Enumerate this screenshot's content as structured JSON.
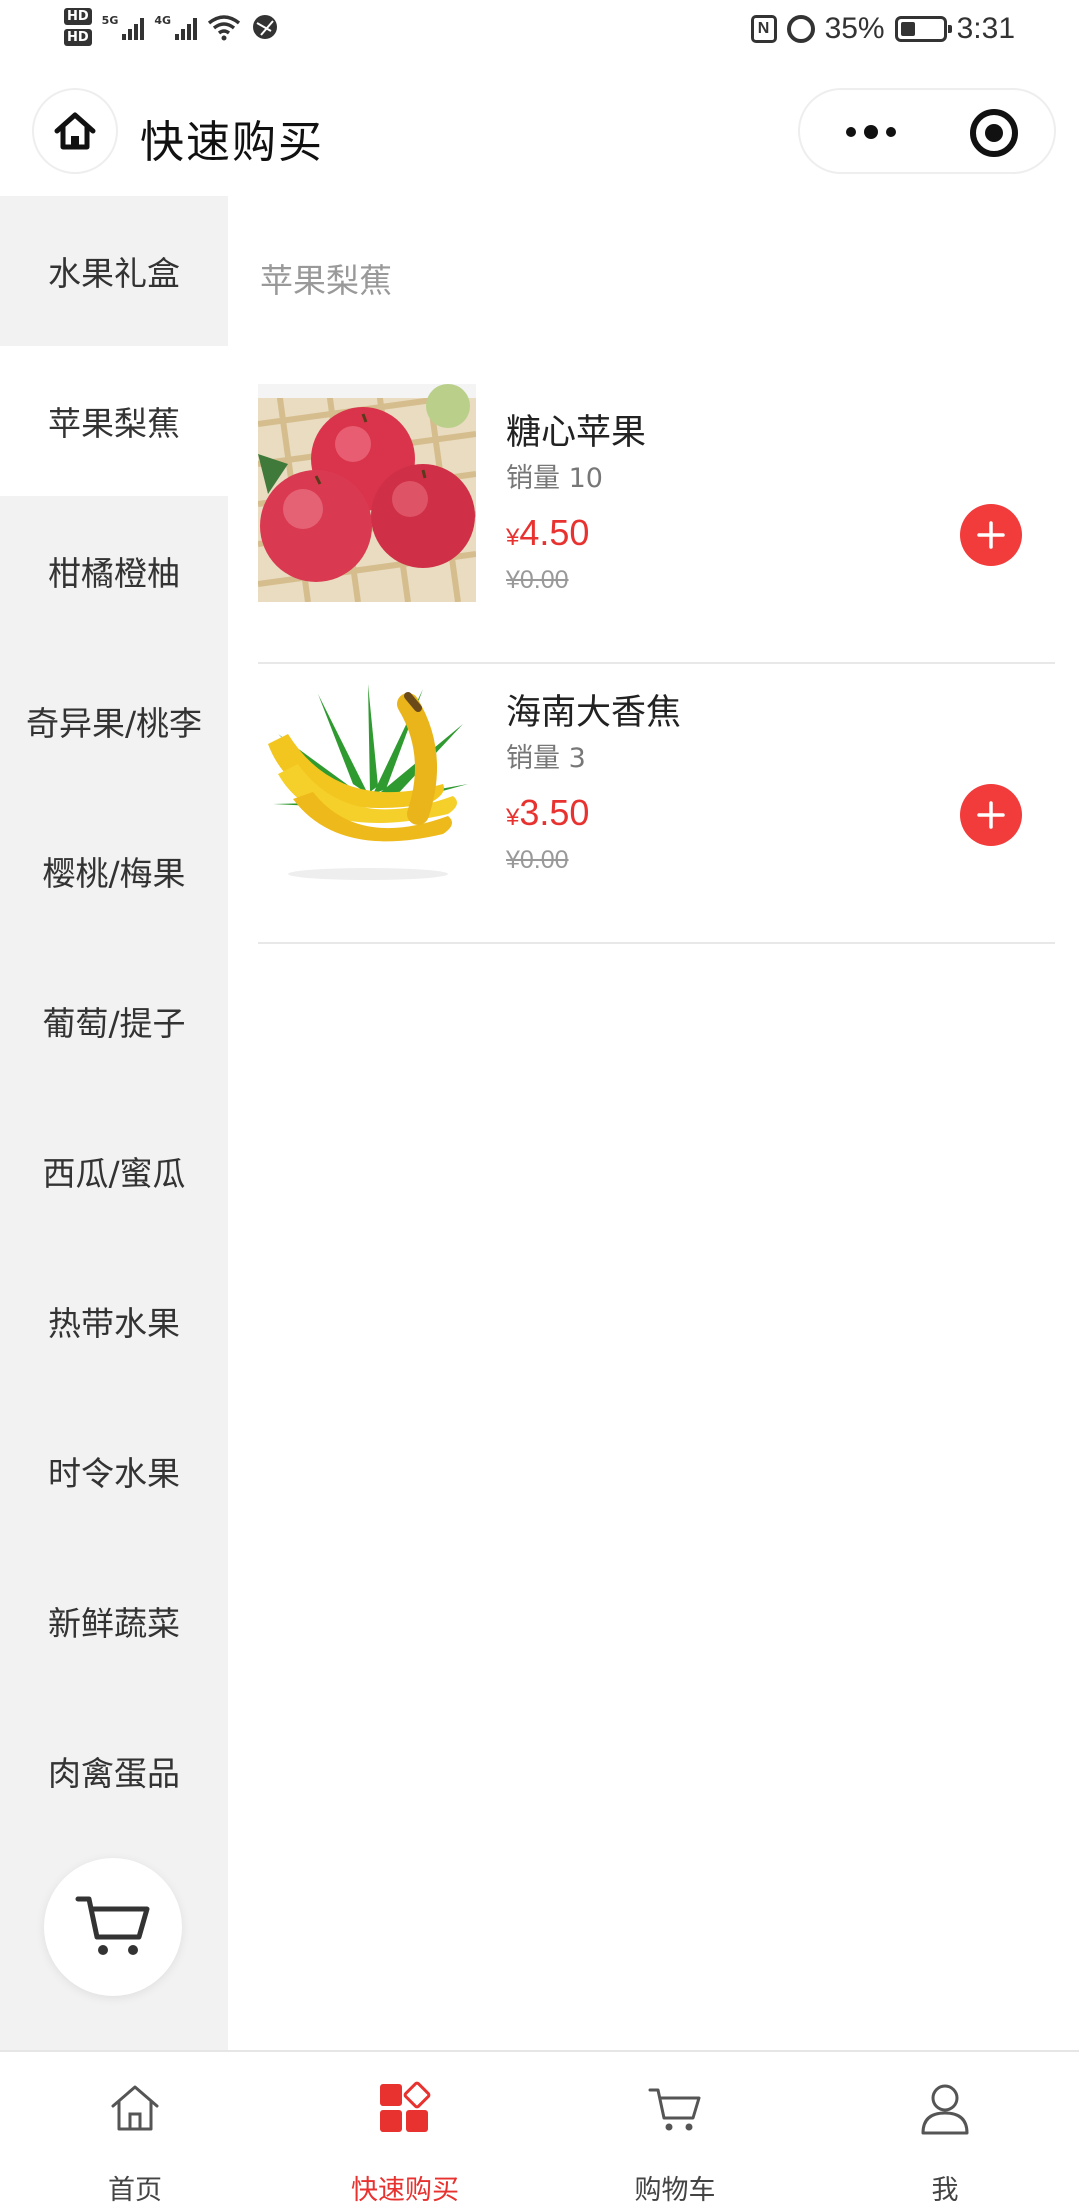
{
  "status_bar": {
    "hd1": "HD",
    "hd2": "HD",
    "net1": "5G",
    "net2": "4G",
    "battery_percent": "35%",
    "battery_level": 0.35,
    "time": "3:31"
  },
  "header": {
    "title": "快速购买"
  },
  "sidebar": {
    "items": [
      {
        "label": "水果礼盒"
      },
      {
        "label": "苹果梨蕉"
      },
      {
        "label": "柑橘橙柚"
      },
      {
        "label": "奇异果/桃李"
      },
      {
        "label": "樱桃/梅果"
      },
      {
        "label": "葡萄/提子"
      },
      {
        "label": "西瓜/蜜瓜"
      },
      {
        "label": "热带水果"
      },
      {
        "label": "时令水果"
      },
      {
        "label": "新鲜蔬菜"
      },
      {
        "label": "肉禽蛋品"
      }
    ],
    "active_index": 1
  },
  "main": {
    "section_title": "苹果梨蕉",
    "products": [
      {
        "name": "糖心苹果",
        "sales": "销量 10",
        "currency": "¥",
        "price": "4.50",
        "original_price": "¥0.00"
      },
      {
        "name": "海南大香焦",
        "sales": "销量 3",
        "currency": "¥",
        "price": "3.50",
        "original_price": "¥0.00"
      }
    ]
  },
  "tabbar": {
    "items": [
      {
        "label": "首页",
        "icon": "home-icon"
      },
      {
        "label": "快速购买",
        "icon": "quick-buy-icon"
      },
      {
        "label": "购物车",
        "icon": "cart-icon"
      },
      {
        "label": "我",
        "icon": "user-icon"
      }
    ],
    "active_index": 1
  },
  "colors": {
    "accent": "#e8322f",
    "add_button": "#f23b3b",
    "sidebar_bg": "#f2f2f2",
    "muted_text": "#999999"
  }
}
